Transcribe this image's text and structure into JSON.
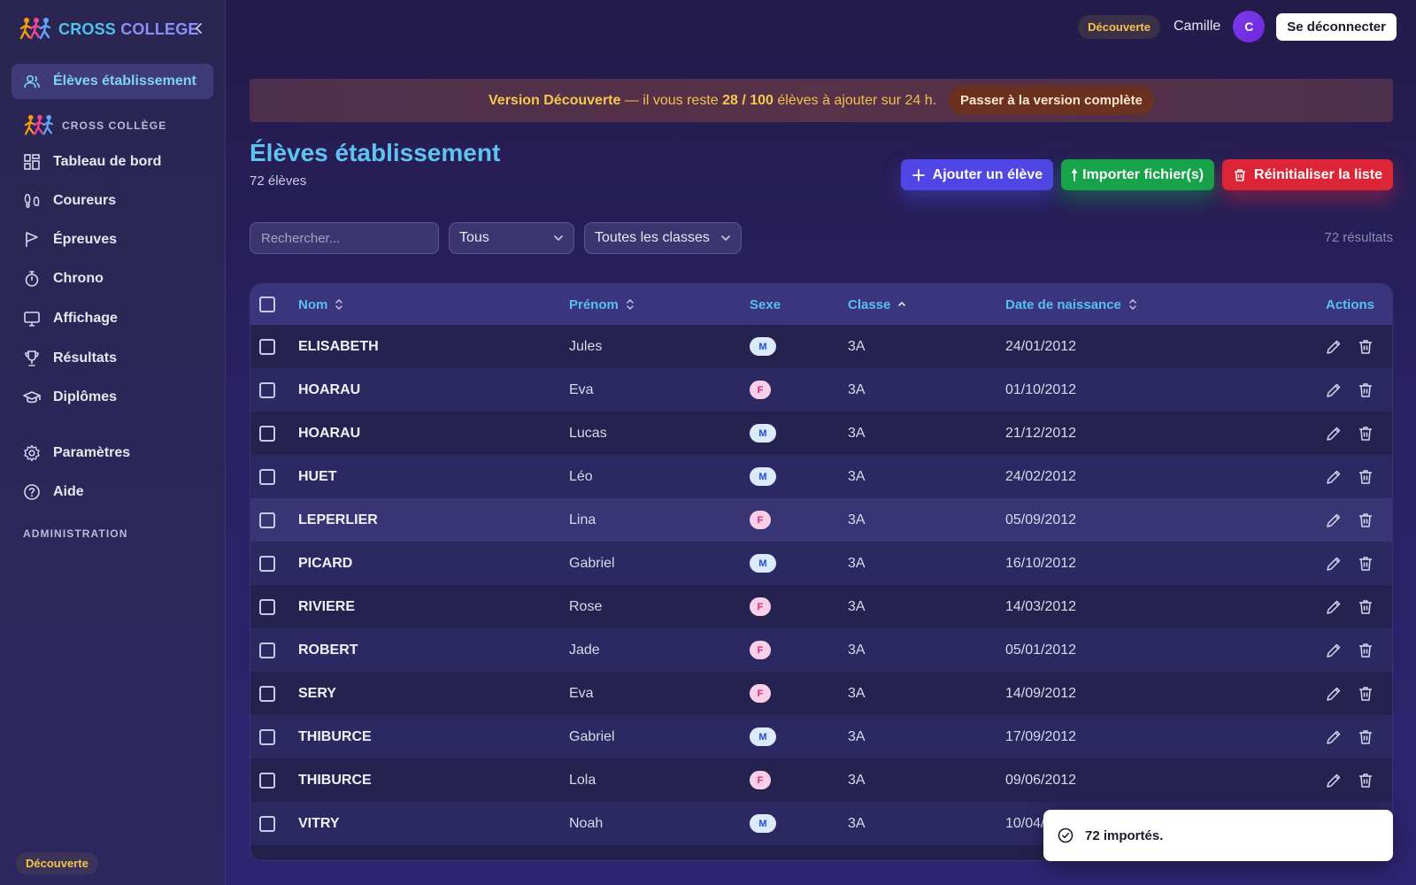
{
  "app": {
    "brand_part1": "CROSS ",
    "brand_part2": "COLLEGE",
    "accent_color": "#5ec3f0",
    "brand_color": "#4fc3ef"
  },
  "sidebar": {
    "active_item": {
      "label": "Élèves établissement",
      "icon": "users-icon"
    },
    "section_title": "CROSS COLLÈGE",
    "items": [
      {
        "label": "Tableau de bord",
        "icon": "dashboard-icon"
      },
      {
        "label": "Coureurs",
        "icon": "footprints-icon"
      },
      {
        "label": "Épreuves",
        "icon": "flag-icon"
      },
      {
        "label": "Chrono",
        "icon": "stopwatch-icon"
      },
      {
        "label": "Affichage",
        "icon": "monitor-icon"
      },
      {
        "label": "Résultats",
        "icon": "trophy-icon"
      },
      {
        "label": "Diplômes",
        "icon": "graduation-cap-icon"
      }
    ],
    "settings_items": [
      {
        "label": "Paramètres",
        "icon": "gear-icon"
      },
      {
        "label": "Aide",
        "icon": "help-icon"
      }
    ],
    "admin_title": "ADMINISTRATION",
    "plan_badge": "Découverte"
  },
  "topbar": {
    "plan_badge": "Découverte",
    "username": "Camille",
    "avatar_initial": "C",
    "logout_label": "Se déconnecter"
  },
  "banner": {
    "prefix": "Version Découverte",
    "text_1": " — il vous reste ",
    "count": "28 / 100",
    "text_2": " élèves à ajouter sur 24 h.",
    "cta": "Passer à la version complète",
    "color": "#f1c04d"
  },
  "page": {
    "title": "Élèves établissement",
    "subtitle": "72 élèves",
    "add_label": "Ajouter un élève",
    "import_label": "Importer fichier(s)",
    "reset_label": "Réinitialiser la liste"
  },
  "filters": {
    "search_placeholder": "Rechercher...",
    "sex_value": "Tous",
    "class_value": "Toutes les classes",
    "results": "72 résultats"
  },
  "table": {
    "columns": {
      "nom": "Nom",
      "prenom": "Prénom",
      "sexe": "Sexe",
      "classe": "Classe",
      "date": "Date de naissance",
      "actions": "Actions"
    },
    "rows": [
      {
        "nom": "ELISABETH",
        "prenom": "Jules",
        "sexe": "M",
        "classe": "3A",
        "date": "24/01/2012"
      },
      {
        "nom": "HOARAU",
        "prenom": "Eva",
        "sexe": "F",
        "classe": "3A",
        "date": "01/10/2012"
      },
      {
        "nom": "HOARAU",
        "prenom": "Lucas",
        "sexe": "M",
        "classe": "3A",
        "date": "21/12/2012"
      },
      {
        "nom": "HUET",
        "prenom": "Léo",
        "sexe": "M",
        "classe": "3A",
        "date": "24/02/2012"
      },
      {
        "nom": "LEPERLIER",
        "prenom": "Lina",
        "sexe": "F",
        "classe": "3A",
        "date": "05/09/2012"
      },
      {
        "nom": "PICARD",
        "prenom": "Gabriel",
        "sexe": "M",
        "classe": "3A",
        "date": "16/10/2012"
      },
      {
        "nom": "RIVIERE",
        "prenom": "Rose",
        "sexe": "F",
        "classe": "3A",
        "date": "14/03/2012"
      },
      {
        "nom": "ROBERT",
        "prenom": "Jade",
        "sexe": "F",
        "classe": "3A",
        "date": "05/01/2012"
      },
      {
        "nom": "SERY",
        "prenom": "Eva",
        "sexe": "F",
        "classe": "3A",
        "date": "14/09/2012"
      },
      {
        "nom": "THIBURCE",
        "prenom": "Gabriel",
        "sexe": "M",
        "classe": "3A",
        "date": "17/09/2012"
      },
      {
        "nom": "THIBURCE",
        "prenom": "Lola",
        "sexe": "F",
        "classe": "3A",
        "date": "09/06/2012"
      },
      {
        "nom": "VITRY",
        "prenom": "Noah",
        "sexe": "M",
        "classe": "3A",
        "date": "10/04/2012"
      }
    ]
  },
  "toast": {
    "text": "72 importés."
  }
}
